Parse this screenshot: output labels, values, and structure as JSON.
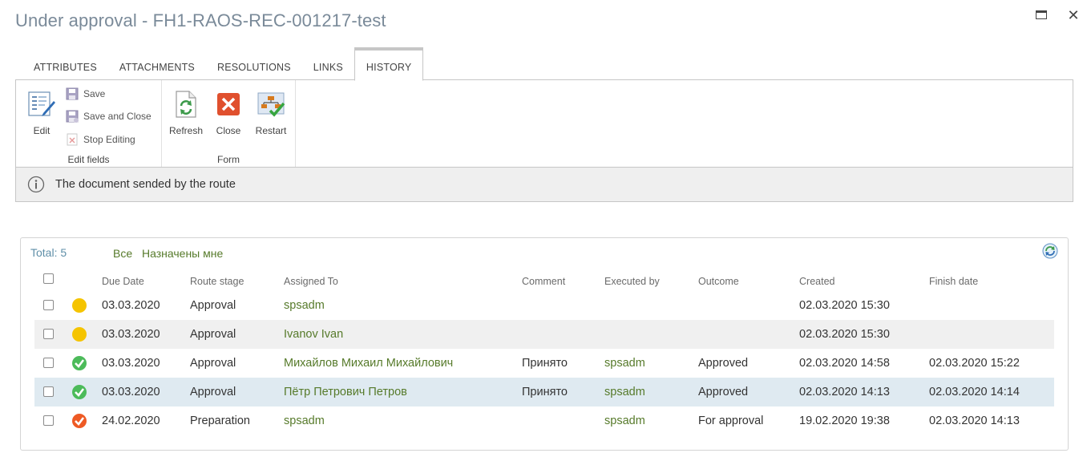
{
  "window": {
    "title": "Under approval - FH1-RAOS-REC-001217-test",
    "close_glyph": "✕"
  },
  "tabs": [
    {
      "label": "ATTRIBUTES"
    },
    {
      "label": "ATTACHMENTS"
    },
    {
      "label": "RESOLUTIONS"
    },
    {
      "label": "LINKS"
    },
    {
      "label": "HISTORY",
      "active": true
    }
  ],
  "ribbon": {
    "edit_fields": {
      "group_label": "Edit fields",
      "edit": "Edit",
      "save": "Save",
      "save_and_close": "Save and Close",
      "stop_editing": "Stop Editing"
    },
    "form": {
      "group_label": "Form",
      "refresh": "Refresh",
      "close": "Close",
      "restart": "Restart"
    }
  },
  "info": {
    "message": "The document sended by the route"
  },
  "history": {
    "total": "Total: 5",
    "filters": [
      "Все",
      "Назначены мне"
    ],
    "columns": {
      "due_date": "Due Date",
      "route_stage": "Route stage",
      "assigned_to": "Assigned To",
      "comment": "Comment",
      "executed_by": "Executed by",
      "outcome": "Outcome",
      "created": "Created",
      "finish_date": "Finish date"
    },
    "rows": [
      {
        "status": "pending",
        "due_date": "03.03.2020",
        "route_stage": "Approval",
        "assigned_to": "spsadm",
        "comment": "",
        "executed_by": "",
        "outcome": "",
        "created": "02.03.2020 15:30",
        "finish_date": ""
      },
      {
        "status": "pending",
        "due_date": "03.03.2020",
        "route_stage": "Approval",
        "assigned_to": "Ivanov Ivan",
        "comment": "",
        "executed_by": "",
        "outcome": "",
        "created": "02.03.2020 15:30",
        "finish_date": ""
      },
      {
        "status": "approved",
        "due_date": "03.03.2020",
        "route_stage": "Approval",
        "assigned_to": "Михайлов Михаил Михайлович",
        "comment": "Принято",
        "executed_by": "spsadm",
        "outcome": "Approved",
        "created": "02.03.2020 14:58",
        "finish_date": "02.03.2020 15:22"
      },
      {
        "status": "approved",
        "due_date": "03.03.2020",
        "route_stage": "Approval",
        "assigned_to": "Пётр Петрович Петров",
        "comment": "Принято",
        "executed_by": "spsadm",
        "outcome": "Approved",
        "created": "02.03.2020 14:13",
        "finish_date": "02.03.2020 14:14"
      },
      {
        "status": "completed",
        "due_date": "24.02.2020",
        "route_stage": "Preparation",
        "assigned_to": "spsadm",
        "comment": "",
        "executed_by": "spsadm",
        "outcome": "For approval",
        "created": "19.02.2020 19:38",
        "finish_date": "02.03.2020 14:13"
      }
    ]
  },
  "colors": {
    "pending": "#f5c400",
    "approved": "#4cbb5a",
    "completed": "#ee5a24",
    "close_red": "#e0502e",
    "link_green": "#567a2a"
  }
}
